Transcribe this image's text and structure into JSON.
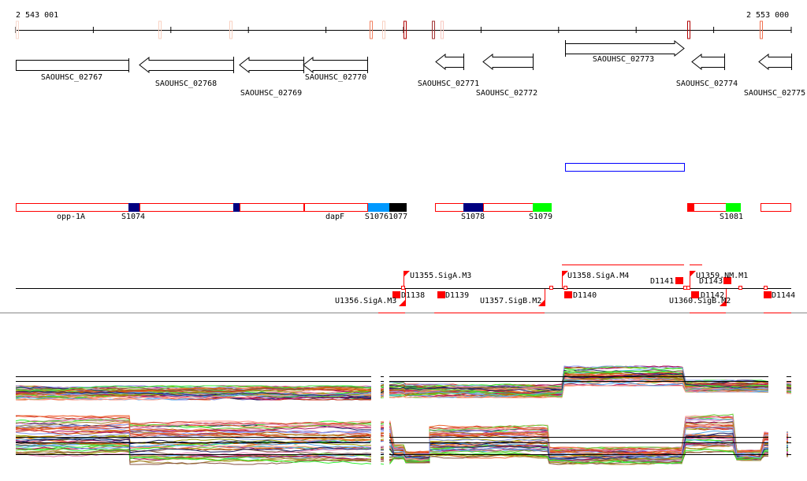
{
  "axis": {
    "start_label": "2 543 001",
    "end_label": "2 553 000"
  },
  "genes": [
    {
      "name": "SAOUHSC_02767",
      "strand": "none"
    },
    {
      "name": "SAOUHSC_02768",
      "strand": "-"
    },
    {
      "name": "SAOUHSC_02769",
      "strand": "-"
    },
    {
      "name": "SAOUHSC_02770",
      "strand": "-"
    },
    {
      "name": "SAOUHSC_02771",
      "strand": "-"
    },
    {
      "name": "SAOUHSC_02772",
      "strand": "-"
    },
    {
      "name": "SAOUHSC_02773",
      "strand": "+"
    },
    {
      "name": "SAOUHSC_02774",
      "strand": "-"
    },
    {
      "name": "SAOUHSC_02775",
      "strand": "-"
    }
  ],
  "segments": {
    "labels": [
      "opp-1A",
      "S1074",
      "dapF",
      "S10761077",
      "S1078",
      "S1079",
      "S1081"
    ],
    "colors": {
      "outline": "#ff0000",
      "navy": "#000080",
      "lightblue": "#0099ff",
      "black": "#000000",
      "green": "#00ff00",
      "red": "#ff0000",
      "blue_outline": "#0000ff"
    }
  },
  "promoters": [
    "U1355.SigA.M3",
    "U1356.SigA.M3",
    "U1357.SigB.M2",
    "U1358.SigA.M4",
    "U1359.NM.M1",
    "U1360.SigB.M2"
  ],
  "terminators": [
    "D1138",
    "D1139",
    "D1140",
    "D1141",
    "D1142",
    "D1143",
    "D1144"
  ]
}
